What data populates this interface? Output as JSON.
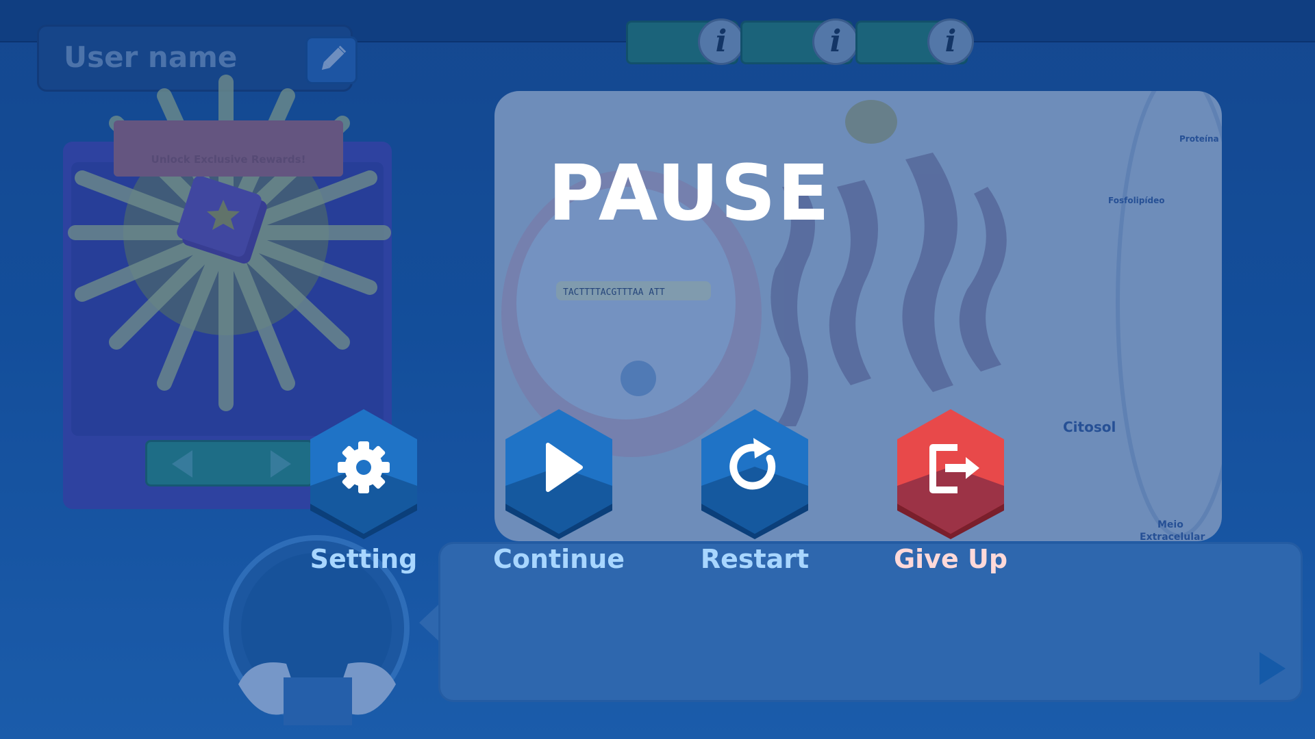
{
  "user": {
    "name": "User name"
  },
  "rewards": {
    "ribbon_text": "Unlock Exclusive Rewards!"
  },
  "cell_labels": {
    "sequence": "TACTTTTACGTTTAA ATT",
    "citosol": "Citosol",
    "proteina": "Proteína",
    "fosfolipideo": "Fosfolipídeo",
    "meio": "Meio",
    "extracelular": "Extracelular"
  },
  "pause": {
    "title": "PAUSE",
    "buttons": [
      {
        "label": "Setting",
        "icon": "gear-icon",
        "color": "#1f73c6"
      },
      {
        "label": "Continue",
        "icon": "play-icon",
        "color": "#1f73c6"
      },
      {
        "label": "Restart",
        "icon": "restart-icon",
        "color": "#1f73c6"
      },
      {
        "label": "Give Up",
        "icon": "exit-icon",
        "color": "#e8494a"
      }
    ]
  },
  "colors": {
    "background": "#1d5a9e",
    "overlay": "#063e96",
    "label_blue": "#a8d6ff",
    "label_red": "#ffd9d9"
  }
}
